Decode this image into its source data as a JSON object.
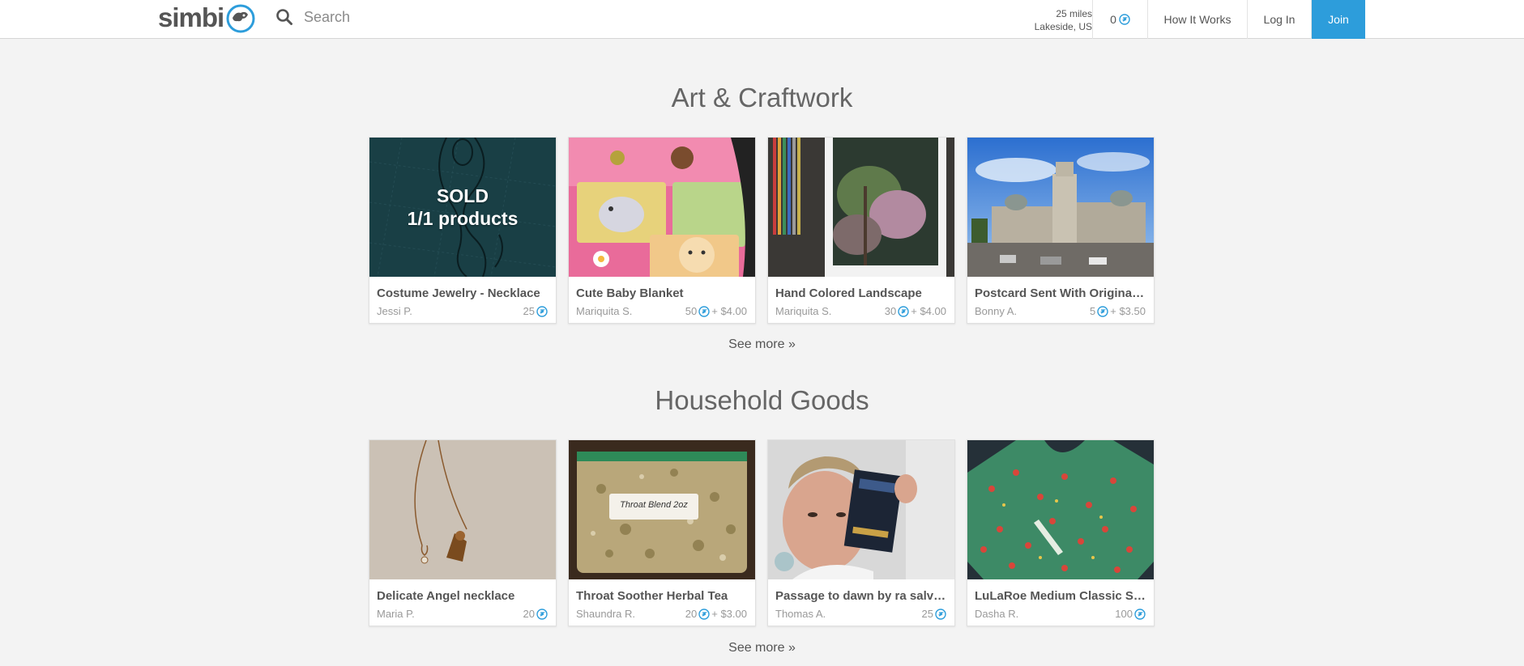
{
  "header": {
    "logo": "simbi",
    "search_placeholder": "Search",
    "location_distance": "25 miles",
    "location_place": "Lakeside, US",
    "points_balance": "0",
    "how_it_works": "How It Works",
    "log_in": "Log In",
    "join": "Join"
  },
  "colors": {
    "accent": "#2d9ddb",
    "background": "#f3f3f3"
  },
  "sections": [
    {
      "title": "Art & Craftwork",
      "see_more": "See more »",
      "items": [
        {
          "title": "Costume Jewelry - Necklace",
          "owner": "Jessi P.",
          "price": "25",
          "shipping": "",
          "sold_line1": "SOLD",
          "sold_line2": "1/1 products"
        },
        {
          "title": "Cute Baby Blanket",
          "owner": "Mariquita S.",
          "price": "50",
          "shipping": "+ $4.00"
        },
        {
          "title": "Hand Colored Landscape",
          "owner": "Mariquita S.",
          "price": "30",
          "shipping": "+ $4.00"
        },
        {
          "title": "Postcard Sent With Original Stamp",
          "owner": "Bonny A.",
          "price": "5",
          "shipping": "+ $3.50"
        }
      ]
    },
    {
      "title": "Household Goods",
      "see_more": "See more »",
      "items": [
        {
          "title": "Delicate Angel necklace",
          "owner": "Maria P.",
          "price": "20",
          "shipping": ""
        },
        {
          "title": "Throat Soother Herbal Tea",
          "owner": "Shaundra R.",
          "price": "20",
          "shipping": "+ $3.00",
          "bag_label": "Throat Blend 2oz"
        },
        {
          "title": "Passage to dawn by ra salvatore",
          "owner": "Thomas A.",
          "price": "25",
          "shipping": ""
        },
        {
          "title": "LuLaRoe Medium Classic Shirt",
          "owner": "Dasha R.",
          "price": "100",
          "shipping": ""
        }
      ]
    }
  ]
}
